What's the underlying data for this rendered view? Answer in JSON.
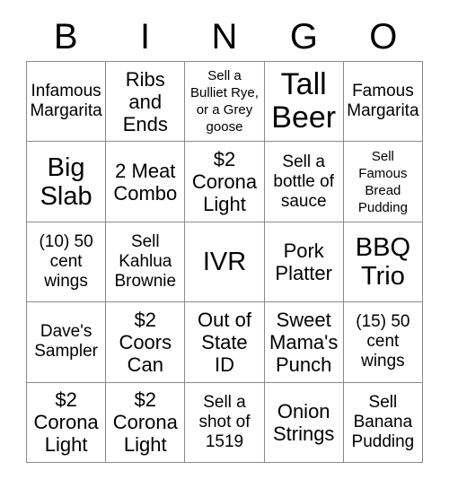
{
  "header": {
    "letters": [
      "B",
      "I",
      "N",
      "G",
      "O"
    ]
  },
  "grid": {
    "rows": [
      [
        {
          "text": "Infamous\nMargarita",
          "size": "fs-sm"
        },
        {
          "text": "Ribs\nand\nEnds",
          "size": "fs-md"
        },
        {
          "text": "Sell a\nBulliet Rye,\nor a Grey\ngoose",
          "size": "fs-xs"
        },
        {
          "text": "Tall\nBeer",
          "size": "fs-xl"
        },
        {
          "text": "Famous\nMargarita",
          "size": "fs-sm"
        }
      ],
      [
        {
          "text": "Big\nSlab",
          "size": "fs-lg"
        },
        {
          "text": "2 Meat\nCombo",
          "size": "fs-md"
        },
        {
          "text": "$2\nCorona\nLight",
          "size": "fs-md"
        },
        {
          "text": "Sell a\nbottle of\nsauce",
          "size": "fs-sm"
        },
        {
          "text": "Sell\nFamous\nBread\nPudding",
          "size": "fs-xs"
        }
      ],
      [
        {
          "text": "(10) 50\ncent\nwings",
          "size": "fs-sm"
        },
        {
          "text": "Sell\nKahlua\nBrownie",
          "size": "fs-sm"
        },
        {
          "text": "IVR",
          "size": "fs-lg"
        },
        {
          "text": "Pork\nPlatter",
          "size": "fs-md"
        },
        {
          "text": "BBQ\nTrio",
          "size": "fs-lg"
        }
      ],
      [
        {
          "text": "Dave's\nSampler",
          "size": "fs-sm"
        },
        {
          "text": "$2\nCoors\nCan",
          "size": "fs-md"
        },
        {
          "text": "Out of\nState\nID",
          "size": "fs-md"
        },
        {
          "text": "Sweet\nMama's\nPunch",
          "size": "fs-md"
        },
        {
          "text": "(15) 50\ncent\nwings",
          "size": "fs-sm"
        }
      ],
      [
        {
          "text": "$2\nCorona\nLight",
          "size": "fs-md"
        },
        {
          "text": "$2\nCorona\nLight",
          "size": "fs-md"
        },
        {
          "text": "Sell a\nshot of\n1519",
          "size": "fs-sm"
        },
        {
          "text": "Onion\nStrings",
          "size": "fs-md"
        },
        {
          "text": "Sell\nBanana\nPudding",
          "size": "fs-sm"
        }
      ]
    ]
  }
}
